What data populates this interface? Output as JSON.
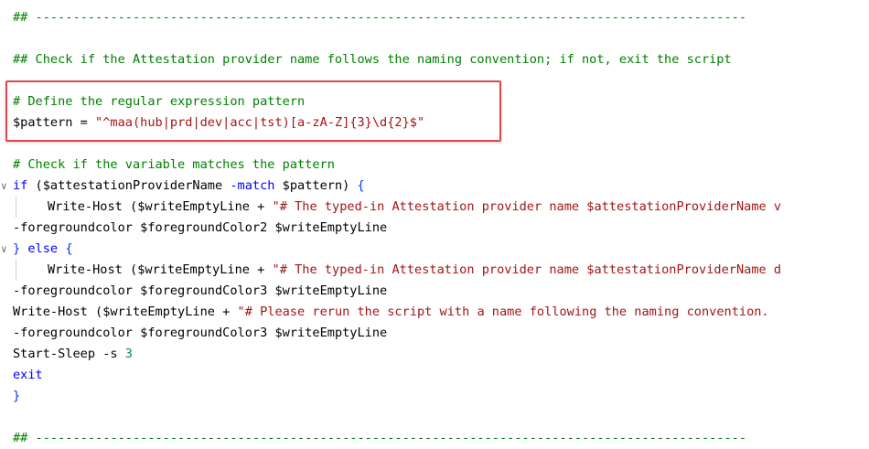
{
  "editor": {
    "language": "powershell",
    "lines": [
      {
        "segments": [
          {
            "cls": "comment",
            "text": "## -----------------------------------------------------------------------------------------------"
          }
        ]
      },
      {
        "segments": []
      },
      {
        "segments": [
          {
            "cls": "comment",
            "text": "## Check if the Attestation provider name follows the naming convention; if not, exit the script"
          }
        ]
      },
      {
        "segments": []
      },
      {
        "segments": [
          {
            "cls": "comment",
            "text": "# Define the regular expression pattern"
          }
        ]
      },
      {
        "segments": [
          {
            "cls": "var",
            "text": "$pattern"
          },
          {
            "cls": "op",
            "text": " = "
          },
          {
            "cls": "str",
            "text": "\"^maa(hub|prd|dev|acc|tst)[a-zA-Z]{3}\\d{2}$\""
          }
        ]
      },
      {
        "segments": []
      },
      {
        "segments": [
          {
            "cls": "comment",
            "text": "# Check if the variable matches the pattern"
          }
        ]
      },
      {
        "fold": "∨",
        "segments": [
          {
            "cls": "kw",
            "text": "if"
          },
          {
            "cls": "op",
            "text": " ("
          },
          {
            "cls": "var",
            "text": "$attestationProviderName"
          },
          {
            "cls": "op",
            "text": " "
          },
          {
            "cls": "kw",
            "text": "-match"
          },
          {
            "cls": "op",
            "text": " "
          },
          {
            "cls": "var",
            "text": "$pattern"
          },
          {
            "cls": "op",
            "text": ") "
          },
          {
            "cls": "brace",
            "text": "{"
          }
        ]
      },
      {
        "guide": true,
        "indent": true,
        "segments": [
          {
            "cls": "plain",
            "text": "Write-Host"
          },
          {
            "cls": "op",
            "text": " ("
          },
          {
            "cls": "var",
            "text": "$writeEmptyLine"
          },
          {
            "cls": "op",
            "text": " + "
          },
          {
            "cls": "str",
            "text": "\"# The typed-in Attestation provider name $attestationProviderName v"
          }
        ]
      },
      {
        "segments": [
          {
            "cls": "plain",
            "text": "-foregroundcolor "
          },
          {
            "cls": "var",
            "text": "$foregroundColor2"
          },
          {
            "cls": "op",
            "text": " "
          },
          {
            "cls": "var",
            "text": "$writeEmptyLine"
          }
        ]
      },
      {
        "fold": "∨",
        "segments": [
          {
            "cls": "brace",
            "text": "}"
          },
          {
            "cls": "op",
            "text": " "
          },
          {
            "cls": "kw",
            "text": "else"
          },
          {
            "cls": "op",
            "text": " "
          },
          {
            "cls": "brace",
            "text": "{"
          }
        ]
      },
      {
        "guide": true,
        "indent": true,
        "segments": [
          {
            "cls": "plain",
            "text": "Write-Host"
          },
          {
            "cls": "op",
            "text": " ("
          },
          {
            "cls": "var",
            "text": "$writeEmptyLine"
          },
          {
            "cls": "op",
            "text": " + "
          },
          {
            "cls": "str",
            "text": "\"# The typed-in Attestation provider name $attestationProviderName d"
          }
        ]
      },
      {
        "segments": [
          {
            "cls": "plain",
            "text": "-foregroundcolor "
          },
          {
            "cls": "var",
            "text": "$foregroundColor3"
          },
          {
            "cls": "op",
            "text": " "
          },
          {
            "cls": "var",
            "text": "$writeEmptyLine"
          }
        ]
      },
      {
        "segments": [
          {
            "cls": "plain",
            "text": "Write-Host"
          },
          {
            "cls": "op",
            "text": " ("
          },
          {
            "cls": "var",
            "text": "$writeEmptyLine"
          },
          {
            "cls": "op",
            "text": " + "
          },
          {
            "cls": "str",
            "text": "\"# Please rerun the script with a name following the naming convention."
          }
        ]
      },
      {
        "segments": [
          {
            "cls": "plain",
            "text": "-foregroundcolor "
          },
          {
            "cls": "var",
            "text": "$foregroundColor3"
          },
          {
            "cls": "op",
            "text": " "
          },
          {
            "cls": "var",
            "text": "$writeEmptyLine"
          }
        ]
      },
      {
        "segments": [
          {
            "cls": "plain",
            "text": "Start-Sleep -s "
          },
          {
            "cls": "num",
            "text": "3"
          }
        ]
      },
      {
        "segments": [
          {
            "cls": "kw",
            "text": "exit"
          }
        ]
      },
      {
        "segments": [
          {
            "cls": "brace",
            "text": "}"
          }
        ]
      },
      {
        "segments": []
      },
      {
        "segments": [
          {
            "cls": "comment",
            "text": "## -----------------------------------------------------------------------------------------------"
          }
        ]
      }
    ]
  },
  "highlight": {
    "color": "#e0464b",
    "covers_lines": [
      4,
      5
    ]
  },
  "colors": {
    "comment": "#008000",
    "keyword": "#0000ff",
    "string": "#a31515",
    "number": "#098658",
    "brace": "#0431fa",
    "text": "#000000"
  }
}
